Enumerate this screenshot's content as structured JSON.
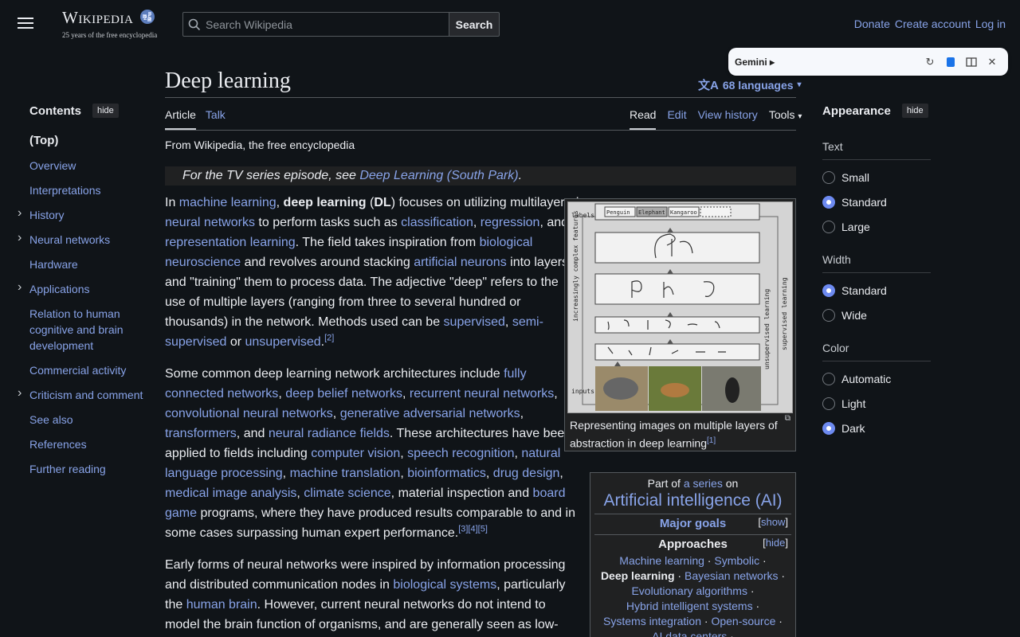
{
  "header": {
    "logo_word": "Wikipedia",
    "logo_tagline": "25 years of the free encyclopedia",
    "search_placeholder": "Search Wikipedia",
    "search_button": "Search",
    "user_links": [
      "Donate",
      "Create account",
      "Log in"
    ]
  },
  "gemini": {
    "title": "Gemini ▸"
  },
  "article_header": {
    "title": "Deep learning",
    "languages": "68 languages",
    "tabs_left": [
      "Article",
      "Talk"
    ],
    "tabs_right": [
      "Read",
      "Edit",
      "View history",
      "Tools"
    ],
    "tagline": "From Wikipedia, the free encyclopedia",
    "hatnote_prefix": "For the TV series episode, see ",
    "hatnote_link": "Deep Learning (South Park)",
    "hatnote_suffix": "."
  },
  "toc": {
    "heading": "Contents",
    "hide": "hide",
    "items": [
      {
        "label": "(Top)",
        "expandable": false
      },
      {
        "label": "Overview",
        "expandable": false
      },
      {
        "label": "Interpretations",
        "expandable": false
      },
      {
        "label": "History",
        "expandable": true
      },
      {
        "label": "Neural networks",
        "expandable": true
      },
      {
        "label": "Hardware",
        "expandable": false
      },
      {
        "label": "Applications",
        "expandable": true
      },
      {
        "label": "Relation to human cognitive and brain development",
        "expandable": false
      },
      {
        "label": "Commercial activity",
        "expandable": false
      },
      {
        "label": "Criticism and comment",
        "expandable": true
      },
      {
        "label": "See also",
        "expandable": false
      },
      {
        "label": "References",
        "expandable": false
      },
      {
        "label": "Further reading",
        "expandable": false
      }
    ]
  },
  "figure": {
    "labels_text": "labels",
    "inputs_text": "inputs",
    "label_boxes": [
      "Penguin",
      "Elephant",
      "Kangaroo"
    ],
    "left_axis": "increasingly complex features",
    "right_axis_1": "unsupervised learning",
    "right_axis_2": "supervised learning",
    "caption": "Representing images on multiple layers of abstraction in deep learning",
    "caption_ref": "[1]"
  },
  "infobox": {
    "part_of_prefix": "Part of ",
    "part_of_link": "a series",
    "part_of_suffix": " on",
    "title": "Artificial intelligence (AI)",
    "major_goals": "Major goals",
    "show": "show",
    "approaches": "Approaches",
    "hide": "hide",
    "approach_items": [
      [
        "Machine learning",
        "Symbolic"
      ],
      [
        "Deep learning",
        "Bayesian networks"
      ],
      [
        "Evolutionary algorithms"
      ],
      [
        "Hybrid intelligent systems"
      ],
      [
        "Systems integration",
        "Open-source"
      ],
      [
        "AI data centers"
      ]
    ]
  },
  "appearance": {
    "heading": "Appearance",
    "hide": "hide",
    "sections": [
      {
        "label": "Text",
        "options": [
          "Small",
          "Standard",
          "Large"
        ],
        "selected": 1
      },
      {
        "label": "Width",
        "options": [
          "Standard",
          "Wide"
        ],
        "selected": 0
      },
      {
        "label": "Color",
        "options": [
          "Automatic",
          "Light",
          "Dark"
        ],
        "selected": 2
      }
    ]
  },
  "colors": {
    "link": "#88a3e8",
    "background": "#101418",
    "text": "#eaecf0",
    "accent": "#6d8af0"
  }
}
